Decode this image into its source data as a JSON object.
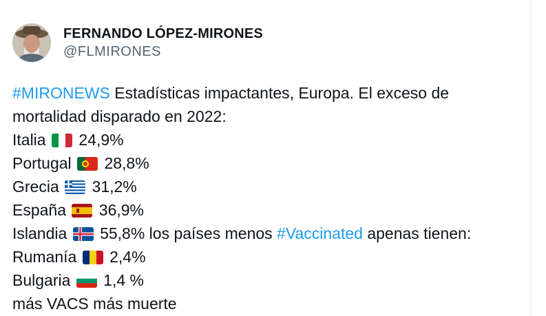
{
  "author": {
    "display_name": "FERNANDO LÓPEZ-MIRONES",
    "handle": "@FLMIRONES"
  },
  "tweet": {
    "line1": {
      "hashtag": "#MIRONEWS",
      "text": " Estadísticas impactantes, Europa. El exceso de"
    },
    "line2": {
      "text": "mortalidad disparado en 2022:"
    },
    "countries": [
      {
        "name": "Italia",
        "flag": "italy-flag",
        "value": "24,9%"
      },
      {
        "name": "Portugal",
        "flag": "portugal-flag",
        "value": "28,8%"
      },
      {
        "name": "Grecia",
        "flag": "greece-flag",
        "value": "31,2%"
      },
      {
        "name": "España",
        "flag": "spain-flag",
        "value": "36,9%"
      }
    ],
    "iceland": {
      "name": "Islandia",
      "flag": "iceland-flag",
      "value_text": "55,8% los países menos ",
      "hashtag": "#Vaccinated",
      "suffix": " apenas tienen:"
    },
    "low_countries": [
      {
        "name": "Rumanía",
        "flag": "romania-flag",
        "value": "2,4%"
      },
      {
        "name": "Bulgaria",
        "flag": "bulgaria-flag",
        "value": "1,4 %"
      }
    ],
    "closing": "más VACS más muerte"
  },
  "colors": {
    "hashtag": "#1d9bf0",
    "text": "#0f1419",
    "handle": "#536471"
  }
}
